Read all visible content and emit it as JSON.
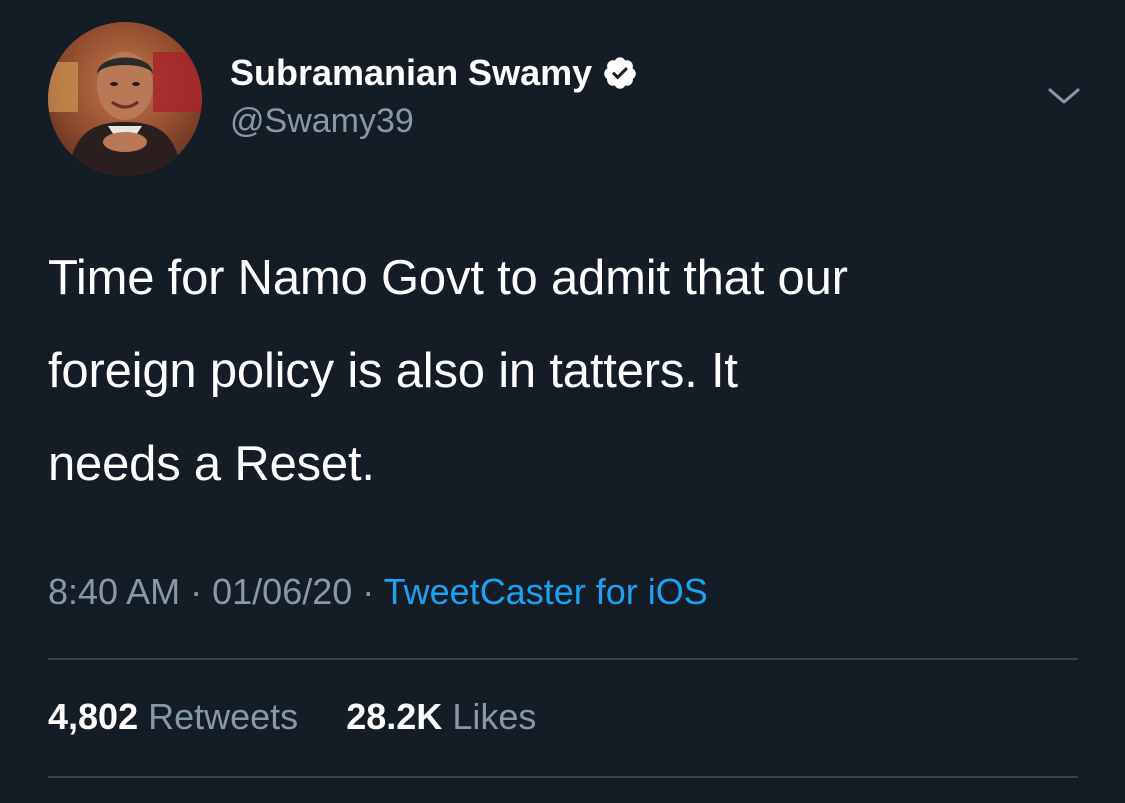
{
  "tweet": {
    "author": {
      "name": "Subramanian Swamy",
      "handle": "@Swamy39",
      "verified": true
    },
    "text": "Time for Namo Govt to admit that our foreign policy is also in tatters. It needs a Reset.",
    "text_lines": [
      "Time for Namo Govt to admit that our",
      "foreign policy is also in tatters. It",
      "needs a Reset."
    ],
    "time": "8:40 AM",
    "date": "01/06/20",
    "separator": "·",
    "source": "TweetCaster for iOS",
    "retweets_count": "4,802",
    "retweets_label": "Retweets",
    "likes_count": "28.2K",
    "likes_label": "Likes"
  },
  "colors": {
    "background": "#141d26",
    "text": "#ffffff",
    "secondary": "#8899a6",
    "link": "#1da1f2",
    "divider": "#38444d"
  },
  "icons": {
    "verified": "verified-badge-icon",
    "menu": "chevron-down-icon"
  }
}
